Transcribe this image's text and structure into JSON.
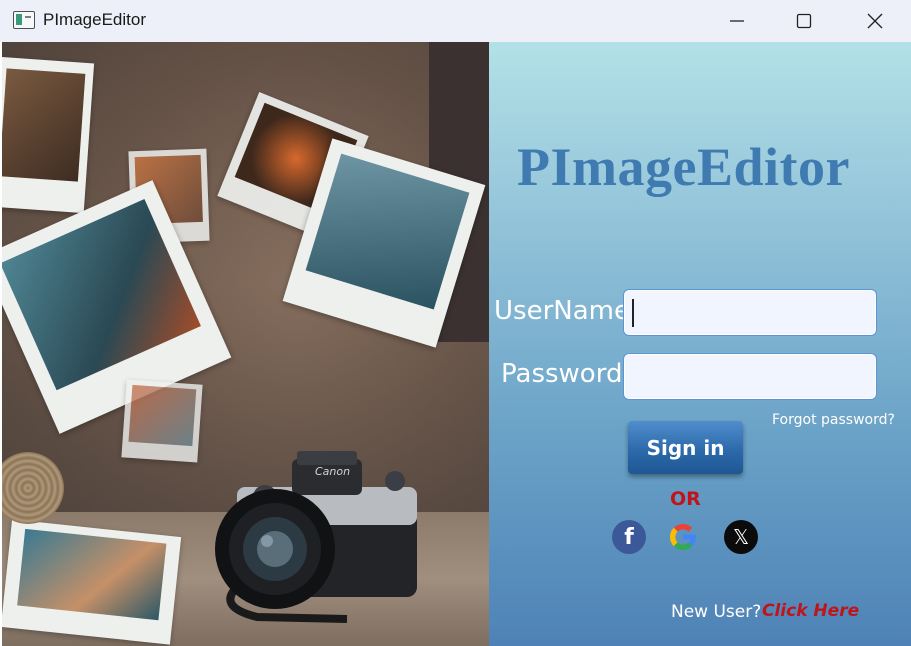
{
  "window": {
    "title": "PImageEditor",
    "controls": [
      "minimize",
      "maximize",
      "close"
    ]
  },
  "brand": {
    "name": "PImageEditor",
    "color": "#3f7ab0"
  },
  "form": {
    "username_label": "UserName",
    "username_value": "",
    "password_label": "Password",
    "password_value": "",
    "forgot_label": "Forgot password?",
    "signin_label": "Sign in",
    "or_label": "OR"
  },
  "social": {
    "facebook_glyph": "f",
    "google_glyph": "G",
    "x_glyph": "𝕏"
  },
  "footer": {
    "new_user_label": "New User?",
    "click_here_label": "Click Here"
  },
  "colors": {
    "accent_red": "#c0141a",
    "signin_blue": "#2c6aab",
    "panel_top": "#b3e1e7",
    "panel_bottom": "#4e82b6"
  },
  "icons": [
    "app-icon",
    "minimize-icon",
    "maximize-icon",
    "close-icon",
    "facebook-icon",
    "google-icon",
    "x-icon"
  ]
}
